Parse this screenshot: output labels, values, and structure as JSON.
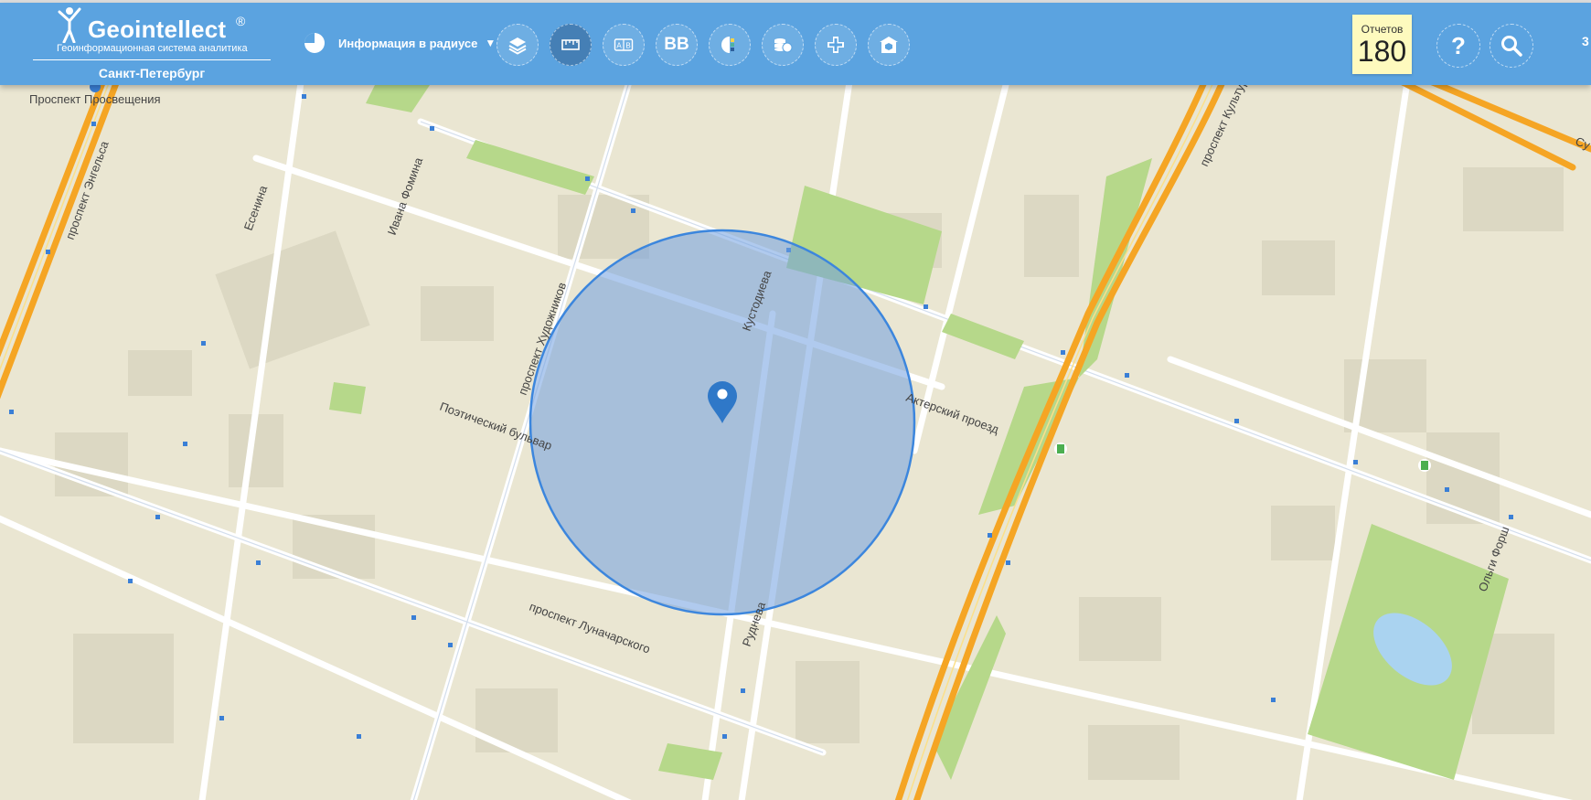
{
  "app": {
    "logo_title": "Geointellect",
    "logo_reg": "®",
    "logo_subtitle": "Геоинформационная система аналитика",
    "city": "Санкт-Петербург"
  },
  "toolbar": {
    "info_mode_label": "Информация в радиусе",
    "info_mode_caret": "▼",
    "tools": [
      {
        "icon": "layers-icon"
      },
      {
        "icon": "ruler-icon"
      },
      {
        "icon": "ab-compare-icon",
        "text": "A B"
      },
      {
        "icon": "bb-icon",
        "text": "BB"
      },
      {
        "icon": "color-palette-icon"
      },
      {
        "icon": "coins-icon"
      },
      {
        "icon": "medical-cross-icon"
      },
      {
        "icon": "school-icon"
      }
    ],
    "reports_label": "Отчетов",
    "reports_count": "180",
    "help_label": "?",
    "edge_char": "3"
  },
  "map": {
    "streets": [
      "Проспект Просвещения",
      "проспект Энгельса",
      "Есенина",
      "Ивана Фомина",
      "проспект Художников",
      "Кустодиева",
      "Поэтический бульвар",
      "Актерский проезд",
      "проспект Культуры",
      "проспект Луначарского",
      "Руднева",
      "Ольги Форш",
      "Су"
    ],
    "colors": {
      "background": "#eae6d2",
      "road_major": "#f5a524",
      "road_minor": "#ffffff",
      "park": "#b6d88a",
      "radius_fill": "#6f9fe0",
      "radius_stroke": "#3c86dd",
      "marker": "#2f78c8"
    }
  }
}
